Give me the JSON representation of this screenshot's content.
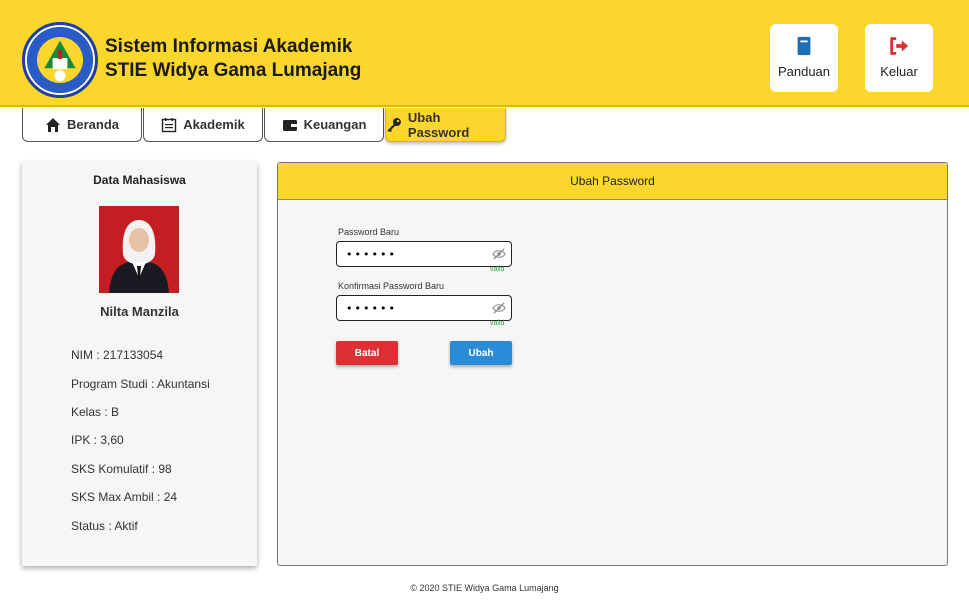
{
  "header": {
    "title_line1": "Sistem Informasi Akademik",
    "title_line2": "STIE Widya Gama Lumajang",
    "logo_text": "SEKOLAH TINGGI ILMU EKONOMI WIDYA GAMA LUMAJANG",
    "logo_center": "STIE",
    "buttons": [
      {
        "label": "Panduan",
        "icon": "book-icon",
        "color": "#1f6fb5"
      },
      {
        "label": "Keluar",
        "icon": "sign-out-icon",
        "color": "#d9302f"
      }
    ]
  },
  "nav": {
    "tabs": [
      {
        "label": "Beranda",
        "icon": "home-icon"
      },
      {
        "label": "Akademik",
        "icon": "calendar-icon"
      },
      {
        "label": "Keuangan",
        "icon": "wallet-icon"
      },
      {
        "label": "Ubah Password",
        "icon": "key-icon",
        "active": true
      }
    ]
  },
  "student": {
    "card_title": "Data Mahasiswa",
    "name": "Nilta Manzila",
    "info": [
      "NIM : 217133054",
      "Program Studi : Akuntansi",
      "Kelas : B",
      "IPK : 3,60",
      "SKS Komulatif : 98",
      "SKS Max Ambil : 24",
      "Status : Aktif"
    ]
  },
  "form": {
    "panel_title": "Ubah Password",
    "new_password_label": "Password Baru",
    "new_password_value": "••••••",
    "confirm_password_label": "Konfirmasi Password Baru",
    "confirm_password_value": "••••••",
    "valid_text": "valid",
    "cancel_label": "Batal",
    "submit_label": "Ubah",
    "cancel_color": "#dc3035",
    "submit_color": "#2a8bd6"
  },
  "footer": {
    "text": "2020 STIE Widya Gama Lumajang"
  },
  "colors": {
    "brand_yellow": "#fbd72d"
  }
}
